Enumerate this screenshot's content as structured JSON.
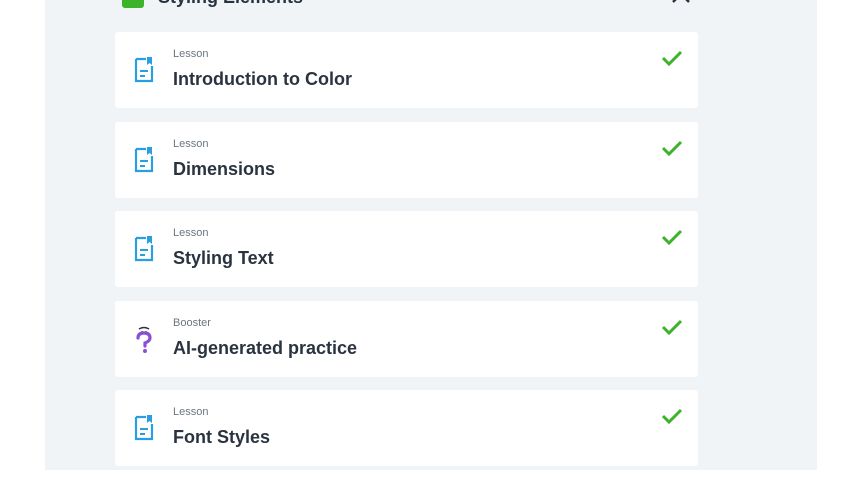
{
  "section": {
    "title": "Styling Elements",
    "check_color": "#3cb329"
  },
  "items": [
    {
      "type": "Lesson",
      "title": "Introduction to Color",
      "icon": "lesson-doc-icon",
      "completed": true
    },
    {
      "type": "Lesson",
      "title": "Dimensions",
      "icon": "lesson-doc-icon",
      "completed": true
    },
    {
      "type": "Lesson",
      "title": "Styling Text",
      "icon": "lesson-doc-icon",
      "completed": true
    },
    {
      "type": "Booster",
      "title": "AI-generated practice",
      "icon": "question-mark-icon",
      "completed": true
    },
    {
      "type": "Lesson",
      "title": "Font Styles",
      "icon": "lesson-doc-icon",
      "completed": true
    }
  ],
  "colors": {
    "panel_bg": "#f0f4f7",
    "card_bg": "#ffffff",
    "lesson_icon": "#2a9fe0",
    "booster_icon": "#8a4fd6",
    "check": "#3cb329",
    "title_text": "#2a3440",
    "type_text": "#6b7682"
  }
}
